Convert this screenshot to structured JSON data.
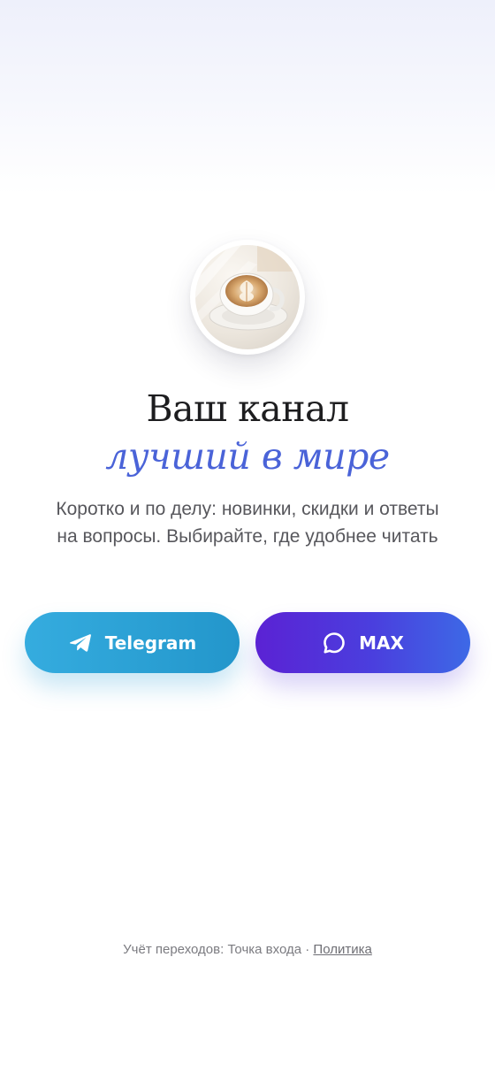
{
  "hero": {
    "avatar_icon": "latte-coffee-cup-photo",
    "title": "Ваш канал",
    "title_accent": "лучший в мире",
    "accent_color": "#4a63d8",
    "description": "Коротко и по делу: новинки, скидки и ответы на вопросы. Выбирайте, где удобнее читать"
  },
  "buttons": {
    "telegram": {
      "label": "Telegram",
      "icon": "telegram-paper-plane-icon",
      "color": "#2a9fd3"
    },
    "max": {
      "label": "MAX",
      "icon": "chat-bubble-icon",
      "color": "#4a3fde"
    }
  },
  "footer": {
    "text": "Учёт переходов: Точка входа · ",
    "policy_link": "Политика"
  }
}
